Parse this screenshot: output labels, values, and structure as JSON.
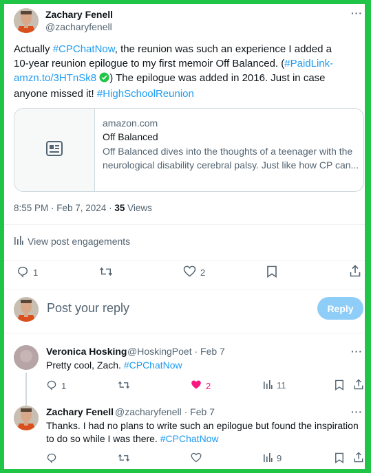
{
  "main_tweet": {
    "author_name": "Zachary Fenell",
    "author_handle": "@zacharyfenell",
    "more_label": "···",
    "text_before_hashtag": "Actually ",
    "hashtag1": "#CPChatNow",
    "text_mid1": ", the reunion was such an experience I added a",
    "text_line2": "10-year reunion epilogue to my first memoir Off Balanced. (",
    "hashtag2": "#PaidLink-",
    "link_text": "amzn.to/3HTnSk8",
    "text_after_link": ") The epilogue was added in 2016. Just in case",
    "text_line4": "anyone missed it! ",
    "hashtag3": "#HighSchoolReunion",
    "card": {
      "domain": "amazon.com",
      "title": "Off Balanced",
      "description_line1": "Off Balanced dives into the thoughts of a teenager with the",
      "description_line2": "neurological disability cerebral palsy. Just like how CP can..."
    },
    "time": "8:55 PM · Feb 7, 2024 · ",
    "views_count": "35",
    "views_label": " Views",
    "engagements_label": "View post engagements",
    "replies": "1",
    "retweets": "",
    "likes": "2"
  },
  "compose": {
    "placeholder": "Post your reply",
    "button_label": "Reply"
  },
  "replies": [
    {
      "author_name": "Veronica Hosking",
      "author_handle": "@HoskingPoet · Feb 7",
      "text": "Pretty cool, Zach. ",
      "hashtag": "#CPChatNow",
      "replies": "1",
      "likes": "2",
      "views": "11",
      "liked": true
    },
    {
      "author_name": "Zachary Fenell",
      "author_handle": "@zacharyfenell · Feb 7",
      "text_line1": "Thanks. I had no plans to write such an epilogue but found the inspiration",
      "text_line2": "to do so while I was there. ",
      "hashtag": "#CPChatNow",
      "views": "9"
    }
  ],
  "colors": {
    "frame_border": "#20c447",
    "link": "#1d9bf0",
    "like_active": "#f91880",
    "reply_button": "#8ecdf8"
  }
}
